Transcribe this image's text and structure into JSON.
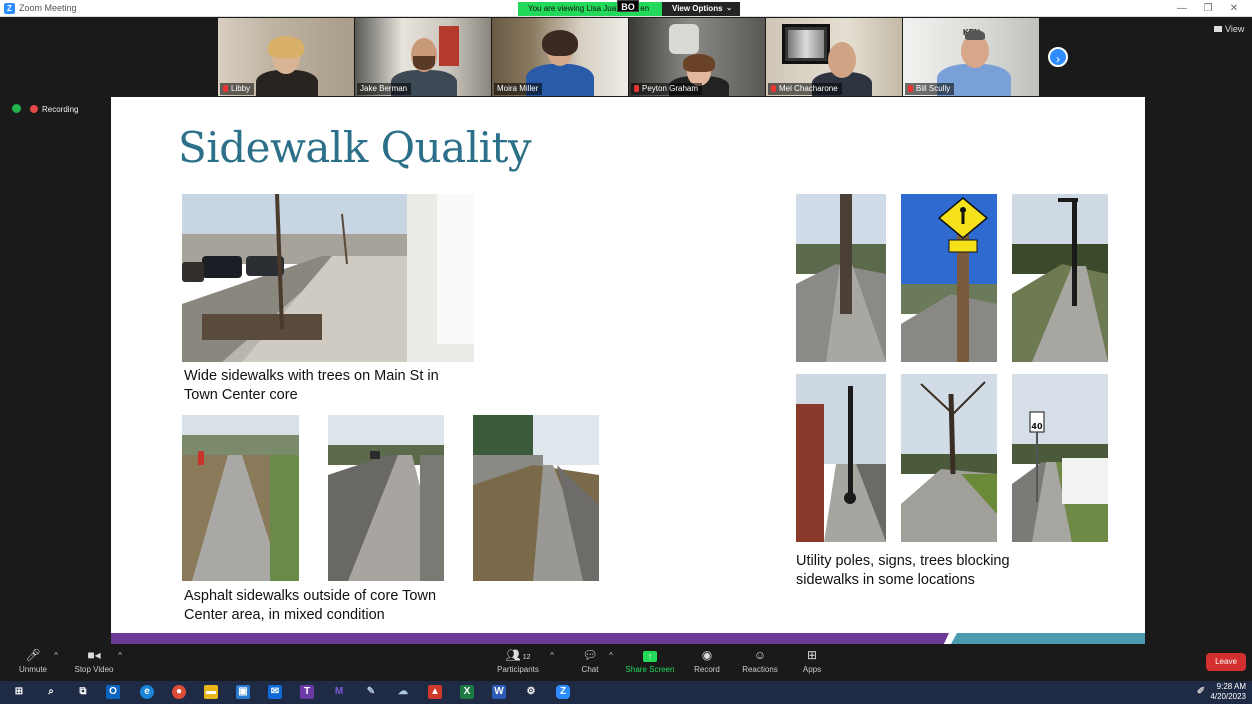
{
  "window": {
    "title": "Zoom Meeting",
    "minimize": "—",
    "restore": "❐",
    "close": "✕"
  },
  "banner": {
    "viewing_text": "You are viewing Lisa Jua",
    "viewing_suffix": "en",
    "view_options": "View Options",
    "caret": "⌄",
    "badge": "BO"
  },
  "view_button": "View",
  "recording": {
    "label": "Recording"
  },
  "participants_thumbs": [
    {
      "name": "Libby"
    },
    {
      "name": "Jake Berman"
    },
    {
      "name": "Moira Miller"
    },
    {
      "name": "Peyton Graham"
    },
    {
      "name": "Mel Chacharone"
    },
    {
      "name": "Bill Scully"
    }
  ],
  "thumb_sign_text": "KEN",
  "next_arrow": "›",
  "slide": {
    "title": "Sidewalk Quality",
    "caption_main": [
      "Wide sidewalks with trees on Main St in",
      "Town Center core"
    ],
    "caption_asphalt": [
      "Asphalt sidewalks outside of core Town",
      "Center area, in mixed condition"
    ],
    "caption_utility": [
      "Utility poles, signs, trees blocking",
      "sidewalks in some locations"
    ],
    "speed_sign": {
      "top": "SPEED LIMIT",
      "value": "40"
    }
  },
  "toolbar": {
    "unmute": "Unmute",
    "stop_video": "Stop Video",
    "participants": "Participants",
    "participants_count": "12",
    "chat": "Chat",
    "share_screen": "Share Screen",
    "record": "Record",
    "reactions": "Reactions",
    "apps": "Apps",
    "leave": "Leave",
    "caret": "^"
  },
  "taskbar": {
    "time": "9:28 AM",
    "date": "4/20/2023"
  },
  "colors": {
    "zoom_blue": "#2d8cff",
    "slide_title": "#2b6f88",
    "leave_red": "#d32f2f",
    "banner_green": "#23d959"
  }
}
